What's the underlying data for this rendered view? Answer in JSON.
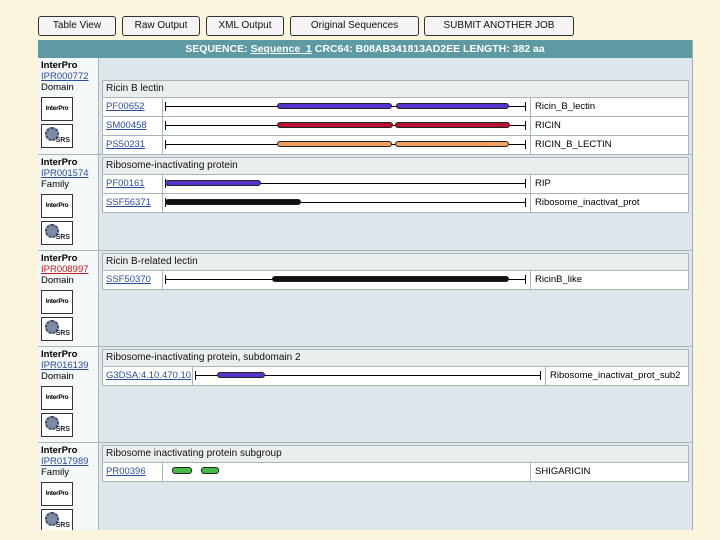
{
  "toolbar": {
    "table_view": "Table View",
    "raw_output": "Raw Output",
    "xml_output": "XML Output",
    "original_sequences": "Original Sequences",
    "submit_another_job": "SUBMIT ANOTHER JOB"
  },
  "sequence": {
    "label": "SEQUENCE:",
    "link": "Sequence_1",
    "details": "CRC64: B08AB341813AD2EE LENGTH: 382 aa"
  },
  "icons": {
    "interpro_logo": "InterPro",
    "srs_logo": "SRS"
  },
  "entries": [
    {
      "db": "InterPro",
      "acc": "IPR000772",
      "type": "Domain",
      "acc_color": "#2a4d9e",
      "title": "Ricin B lectin",
      "rows": [
        {
          "acc": "PF00652",
          "name": "Ricin_B_lectin"
        },
        {
          "acc": "SM00458",
          "name": "RICIN"
        },
        {
          "acc": "PS50231",
          "name": "RICIN_B_LECTIN"
        }
      ]
    },
    {
      "db": "InterPro",
      "acc": "IPR001574",
      "type": "Family",
      "acc_color": "#2a4d9e",
      "title": "Ribosome-inactivating protein",
      "rows": [
        {
          "acc": "PF00161",
          "name": "RIP"
        },
        {
          "acc": "SSF56371",
          "name": "Ribosome_inactivat_prot"
        }
      ]
    },
    {
      "db": "InterPro",
      "acc": "IPR008997",
      "type": "Domain",
      "acc_color": "#c02020",
      "title": "Ricin B-related lectin",
      "rows": [
        {
          "acc": "SSF50370",
          "name": "RicinB_like"
        }
      ]
    },
    {
      "db": "InterPro",
      "acc": "IPR016139",
      "type": "Domain",
      "acc_color": "#2a4d9e",
      "title": "Ribosome-inactivating protein, subdomain 2",
      "rows": [
        {
          "acc": "G3DSA:4.10.470.10",
          "name": "Ribosome_inactivat_prot_sub2"
        }
      ]
    },
    {
      "db": "InterPro",
      "acc": "IPR017989",
      "type": "Family",
      "acc_color": "#2a4d9e",
      "title": "Ribosome inactivating protein subgroup",
      "rows": [
        {
          "acc": "PR00396",
          "name": "SHIGARICIN"
        }
      ]
    }
  ]
}
